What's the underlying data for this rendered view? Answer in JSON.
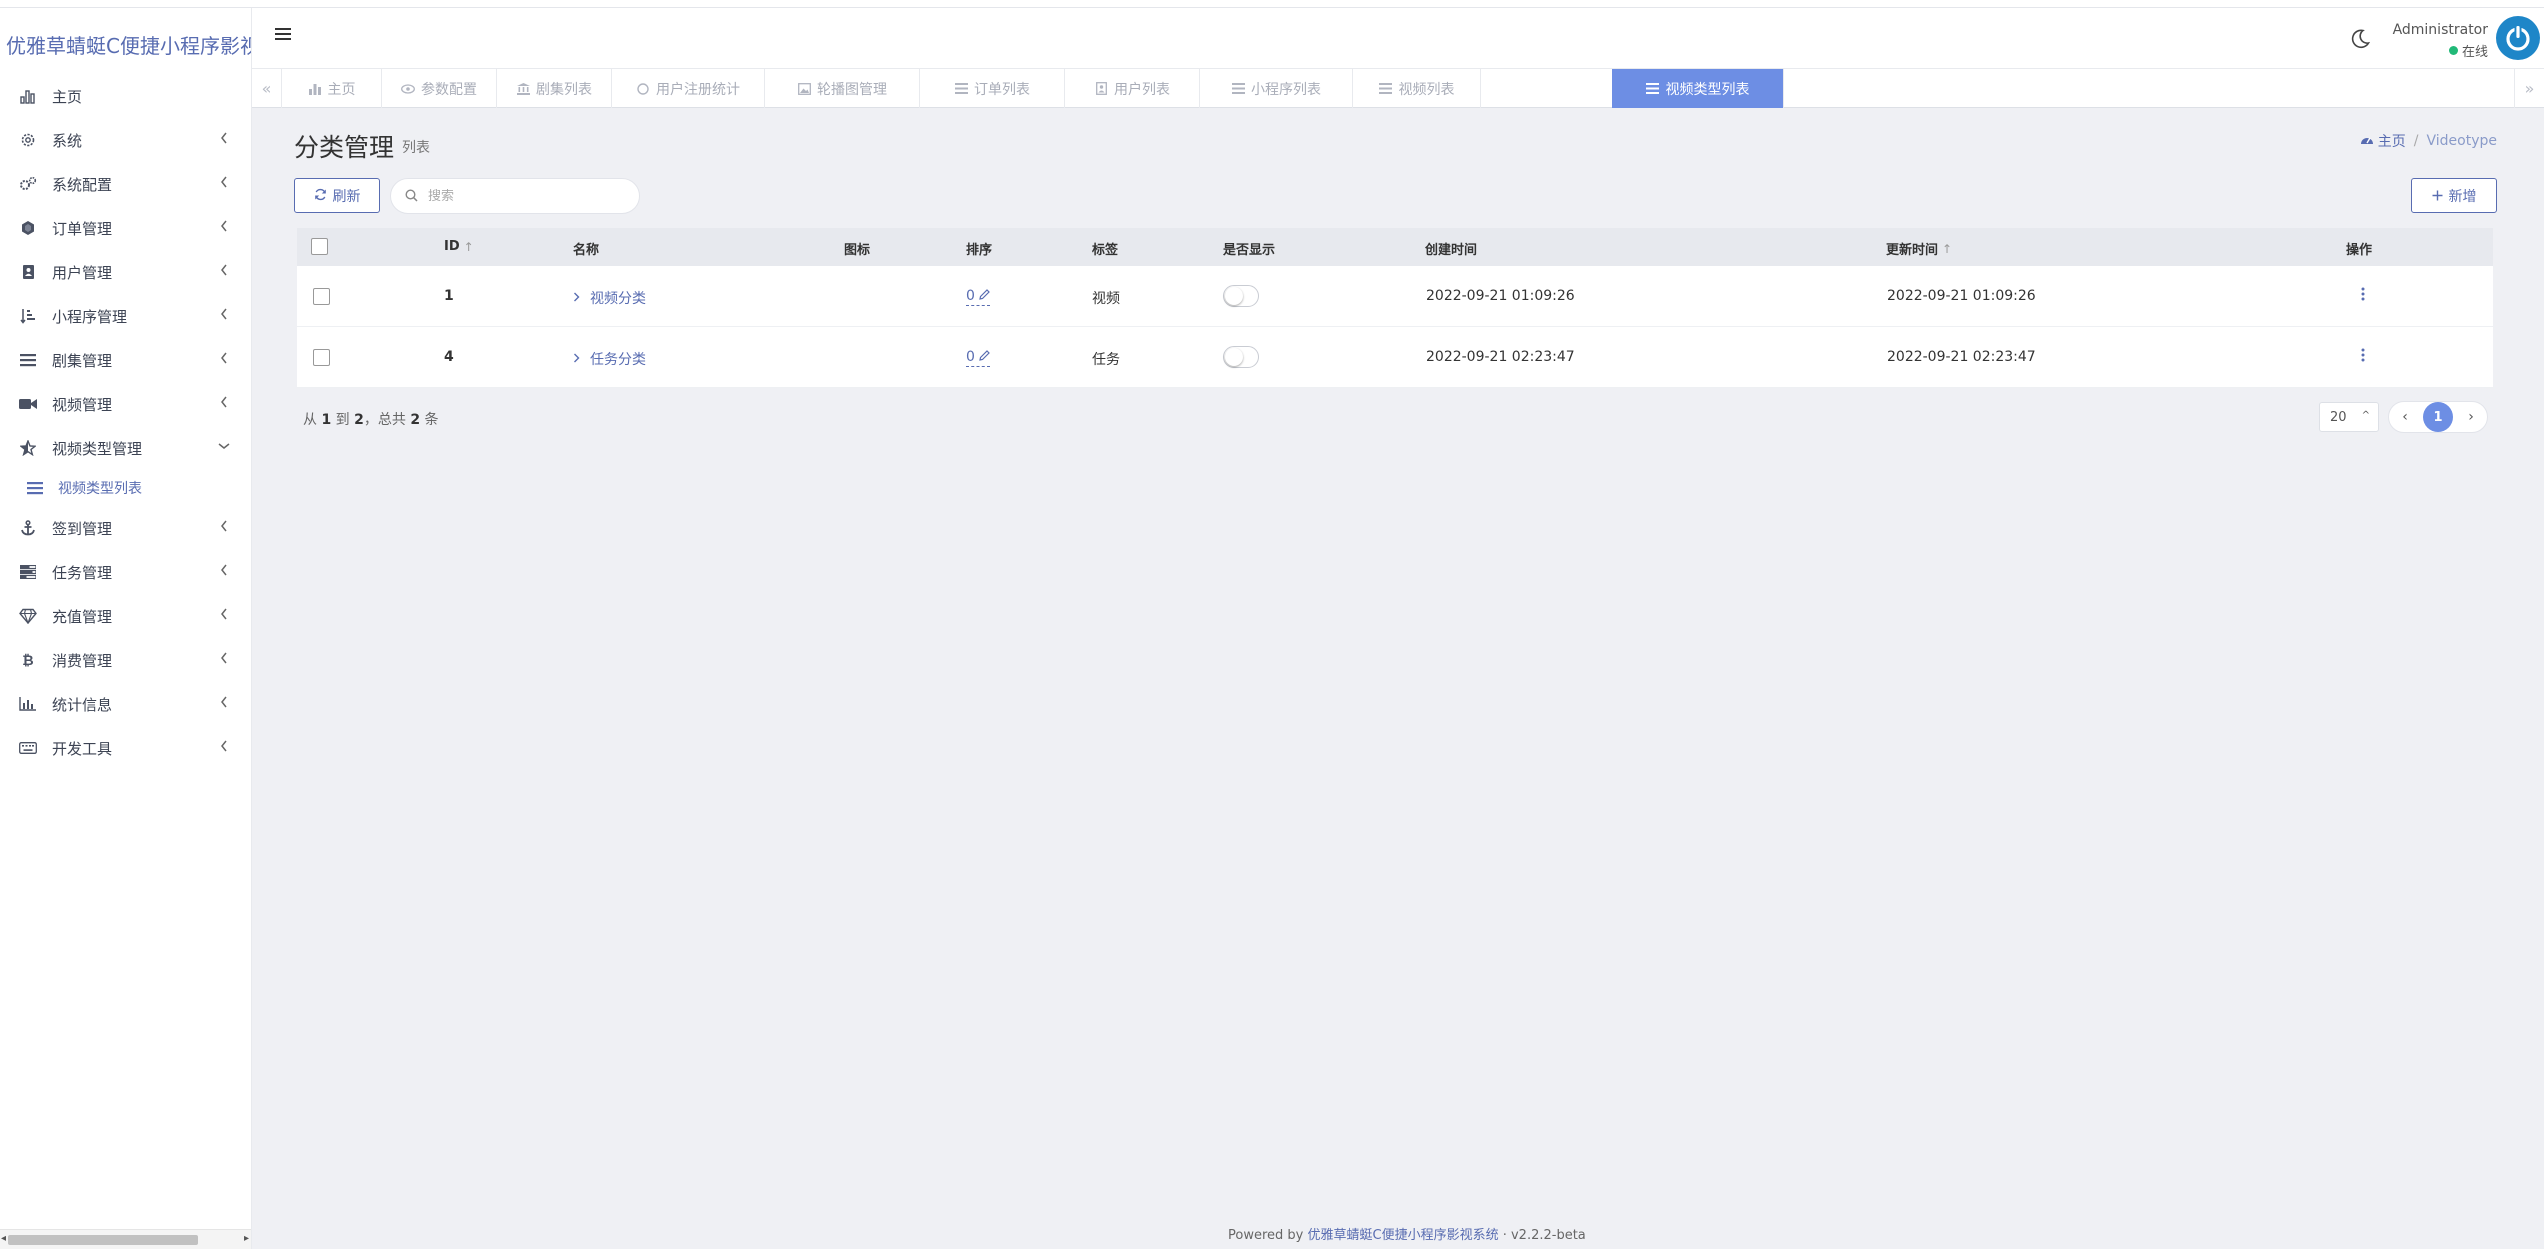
{
  "brand": "优雅草蜻蜓C便捷小程序影视",
  "sidebar": {
    "items": [
      {
        "label": "主页",
        "icon": "bar-chart-icon",
        "arrow": false
      },
      {
        "label": "系统",
        "icon": "gear-icon",
        "arrow": true
      },
      {
        "label": "系统配置",
        "icon": "gears-icon",
        "arrow": true
      },
      {
        "label": "订单管理",
        "icon": "hexagon-icon",
        "arrow": true
      },
      {
        "label": "用户管理",
        "icon": "address-book-icon",
        "arrow": true
      },
      {
        "label": "小程序管理",
        "icon": "sort-amount-icon",
        "arrow": true
      },
      {
        "label": "剧集管理",
        "icon": "list-icon",
        "arrow": true
      },
      {
        "label": "视频管理",
        "icon": "video-camera-icon",
        "arrow": true
      },
      {
        "label": "视频类型管理",
        "icon": "star-half-icon",
        "arrow": "down"
      },
      {
        "label": "签到管理",
        "icon": "anchor-icon",
        "arrow": true
      },
      {
        "label": "任务管理",
        "icon": "tasks-icon",
        "arrow": true
      },
      {
        "label": "充值管理",
        "icon": "diamond-icon",
        "arrow": true
      },
      {
        "label": "消费管理",
        "icon": "bitcoin-icon",
        "arrow": true
      },
      {
        "label": "统计信息",
        "icon": "line-chart-icon",
        "arrow": true
      },
      {
        "label": "开发工具",
        "icon": "keyboard-icon",
        "arrow": true
      }
    ],
    "subitem": {
      "label": "视频类型列表",
      "icon": "list-icon"
    }
  },
  "header": {
    "admin_name": "Administrator",
    "status": "在线"
  },
  "tabs": [
    {
      "label": "主页",
      "icon": "bar-chart-icon",
      "active": false
    },
    {
      "label": "参数配置",
      "icon": "eye-icon",
      "active": false
    },
    {
      "label": "剧集列表",
      "icon": "bank-icon",
      "active": false
    },
    {
      "label": "用户注册统计",
      "icon": "circle-icon",
      "active": false
    },
    {
      "label": "轮播图管理",
      "icon": "image-icon",
      "active": false
    },
    {
      "label": "订单列表",
      "icon": "list-icon",
      "active": false
    },
    {
      "label": "用户列表",
      "icon": "user-file-icon",
      "active": false
    },
    {
      "label": "小程序列表",
      "icon": "list-icon",
      "active": false
    },
    {
      "label": "视频列表",
      "icon": "list-icon",
      "active": false
    },
    {
      "label": "视频类型列表",
      "icon": "list-icon",
      "active": true
    }
  ],
  "page": {
    "title": "分类管理",
    "subtitle": "列表"
  },
  "breadcrumb": {
    "home": "主页",
    "current": "Videotype"
  },
  "toolbar": {
    "refresh_label": "刷新",
    "search_placeholder": "搜索",
    "new_label": "新增"
  },
  "table": {
    "columns": [
      "ID",
      "名称",
      "图标",
      "排序",
      "标签",
      "是否显示",
      "创建时间",
      "更新时间",
      "操作"
    ],
    "rows": [
      {
        "id": "1",
        "name": "视频分类",
        "icon": "",
        "order": "0",
        "tag": "视频",
        "show": false,
        "created": "2022-09-21 01:09:26",
        "updated": "2022-09-21 01:09:26"
      },
      {
        "id": "4",
        "name": "任务分类",
        "icon": "",
        "order": "0",
        "tag": "任务",
        "show": false,
        "created": "2022-09-21 02:23:47",
        "updated": "2022-09-21 02:23:47"
      }
    ]
  },
  "footer": {
    "from_label": "从",
    "from": "1",
    "to_label": "到",
    "to": "2",
    "total_label": "，总共",
    "total": "2",
    "unit": "条"
  },
  "pagination": {
    "per_page": "20",
    "current_page": "1"
  },
  "powered": {
    "prefix": "Powered by",
    "link": "优雅草蜻蜓C便捷小程序影视系统",
    "version": "· v2.2.2-beta"
  },
  "colors": {
    "accent": "#586cb1",
    "active_tab": "#6d8ee4",
    "online": "#21b978"
  }
}
